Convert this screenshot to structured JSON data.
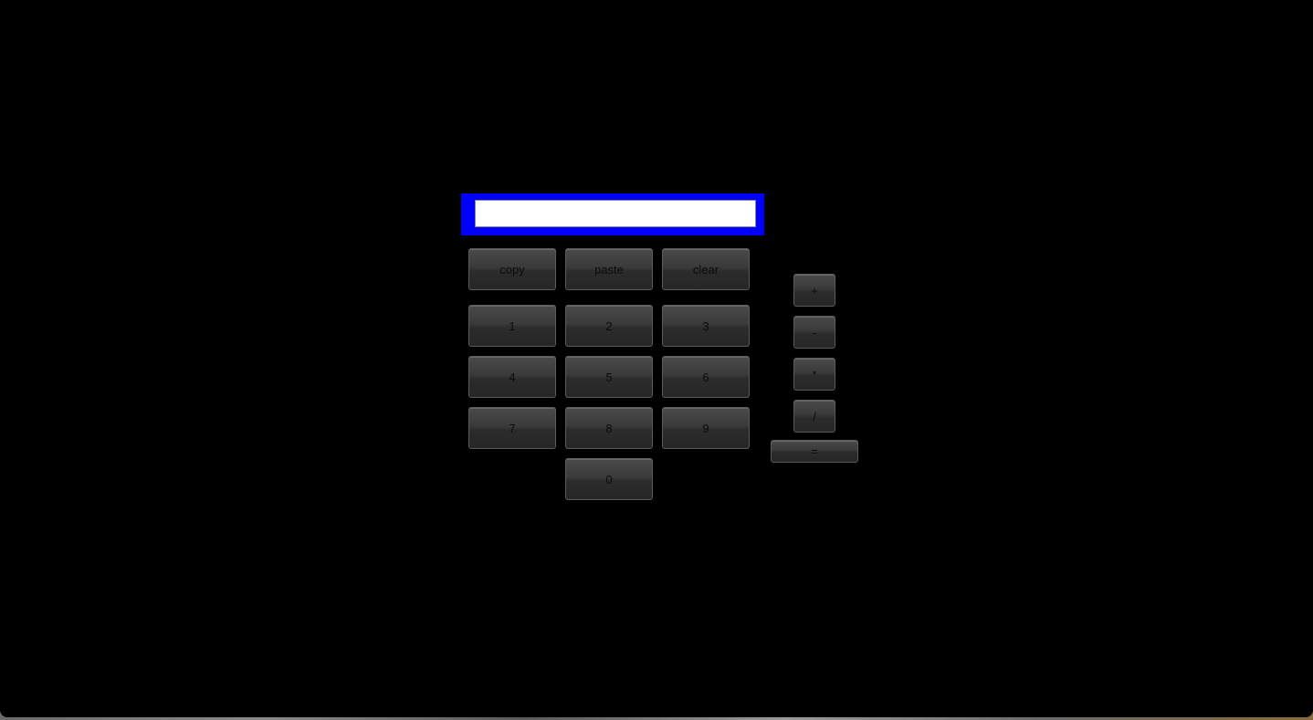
{
  "display": {
    "value": "",
    "placeholder": ""
  },
  "edit_row": {
    "copy": "copy",
    "paste": "paste",
    "clear": "clear"
  },
  "digits": {
    "d1": "1",
    "d2": "2",
    "d3": "3",
    "d4": "4",
    "d5": "5",
    "d6": "6",
    "d7": "7",
    "d8": "8",
    "d9": "9",
    "d0": "0"
  },
  "operators": {
    "plus": "+",
    "minus": "-",
    "multiply": "*",
    "divide": "/",
    "equals": "="
  },
  "colors": {
    "background": "#000000",
    "display_frame": "#0000ff",
    "display_field": "#ffffff",
    "button": "#333333"
  }
}
